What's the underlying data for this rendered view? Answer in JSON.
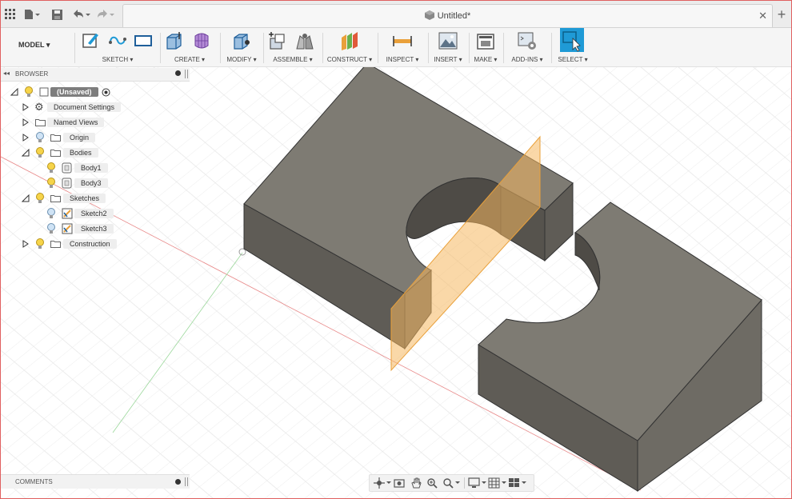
{
  "window": {
    "title": "Untitled*"
  },
  "workspace": {
    "label": "MODEL ▾"
  },
  "toolbar": {
    "groups": [
      {
        "label": "SKETCH ▾"
      },
      {
        "label": "CREATE ▾"
      },
      {
        "label": "MODIFY ▾"
      },
      {
        "label": "ASSEMBLE ▾"
      },
      {
        "label": "CONSTRUCT ▾"
      },
      {
        "label": "INSPECT ▾"
      },
      {
        "label": "INSERT ▾"
      },
      {
        "label": "MAKE ▾"
      },
      {
        "label": "ADD-INS ▾"
      },
      {
        "label": "SELECT ▾"
      }
    ]
  },
  "browser": {
    "title": "BROWSER",
    "root": "(Unsaved)",
    "items": [
      {
        "label": "Document Settings"
      },
      {
        "label": "Named Views"
      },
      {
        "label": "Origin"
      },
      {
        "label": "Bodies"
      },
      {
        "label": "Body1"
      },
      {
        "label": "Body3"
      },
      {
        "label": "Sketches"
      },
      {
        "label": "Sketch2"
      },
      {
        "label": "Sketch3"
      },
      {
        "label": "Construction"
      }
    ]
  },
  "comments": {
    "label": "COMMENTS"
  },
  "colors": {
    "body_face": "#7e7b73",
    "body_side": "#5e5b55",
    "plane": "#f5b860",
    "accent": "#1f9ad6"
  }
}
